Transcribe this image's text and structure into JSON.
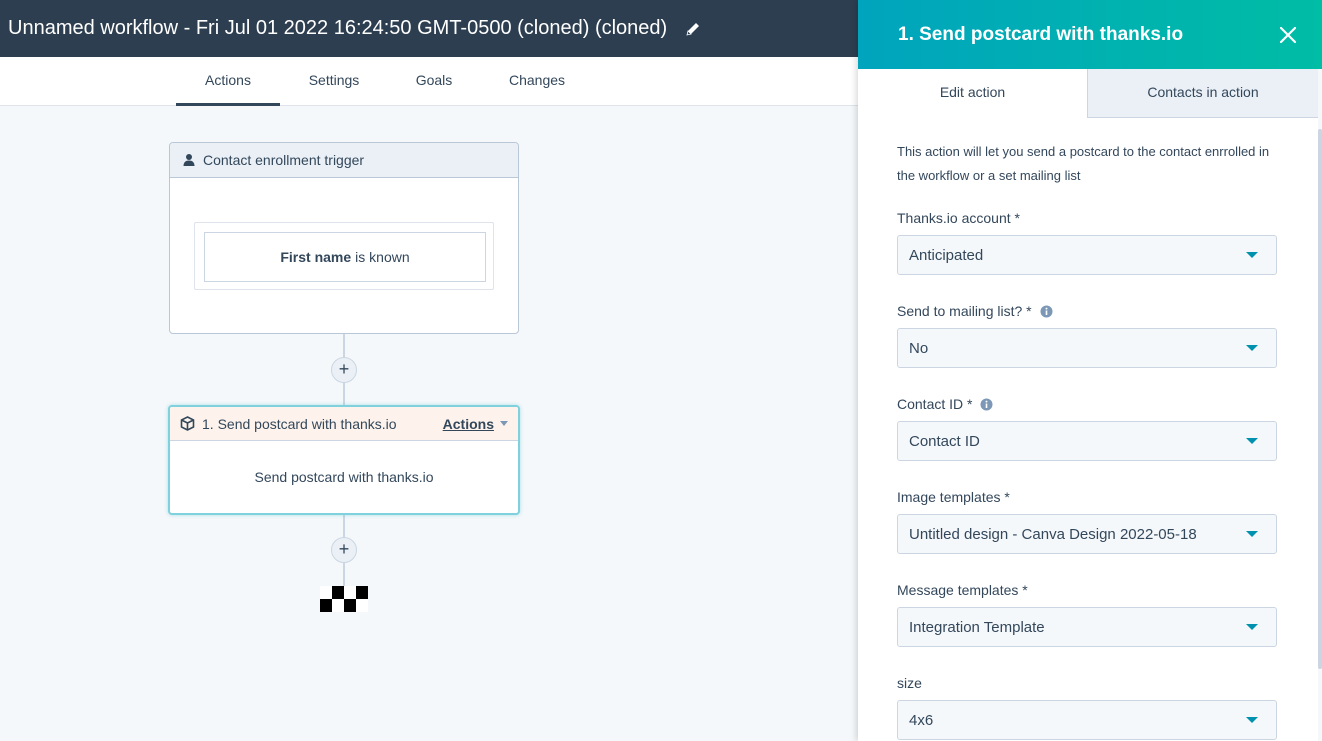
{
  "header": {
    "title": "Unnamed workflow - Fri Jul 01 2022 16:24:50 GMT-0500 (cloned) (cloned)",
    "edit_icon": "pencil-icon"
  },
  "tabs": [
    {
      "label": "Actions",
      "active": true
    },
    {
      "label": "Settings",
      "active": false
    },
    {
      "label": "Goals",
      "active": false
    },
    {
      "label": "Changes",
      "active": false
    }
  ],
  "trigger": {
    "icon": "person-icon",
    "title": "Contact enrollment trigger",
    "filter_property": "First name",
    "filter_condition": "is known"
  },
  "action_card": {
    "icon": "box-icon",
    "title": "1. Send postcard with thanks.io",
    "menu_label": "Actions",
    "body": "Send postcard with thanks.io"
  },
  "panel": {
    "title": "1. Send postcard with thanks.io",
    "close_icon": "close-icon",
    "tabs": [
      {
        "label": "Edit action",
        "active": true
      },
      {
        "label": "Contacts in action",
        "active": false
      }
    ],
    "description": "This action will let you send a postcard to the contact enrrolled in the workflow or a set mailing list",
    "fields": [
      {
        "label": "Thanks.io account *",
        "value": "Anticipated",
        "info": false
      },
      {
        "label": "Send to mailing list? *",
        "value": "No",
        "info": true
      },
      {
        "label": "Contact ID *",
        "value": "Contact ID",
        "info": true
      },
      {
        "label": "Image templates *",
        "value": "Untitled design - Canva Design 2022-05-18",
        "info": false
      },
      {
        "label": "Message templates *",
        "value": "Integration Template",
        "info": false
      },
      {
        "label": "size",
        "value": "4x6",
        "info": false
      }
    ]
  },
  "colors": {
    "header_bg": "#2d3e50",
    "panel_gradient_start": "#00a4bd",
    "panel_gradient_end": "#00bda5",
    "action_border": "#7fd1de",
    "dropdown_caret": "#0091ae"
  }
}
